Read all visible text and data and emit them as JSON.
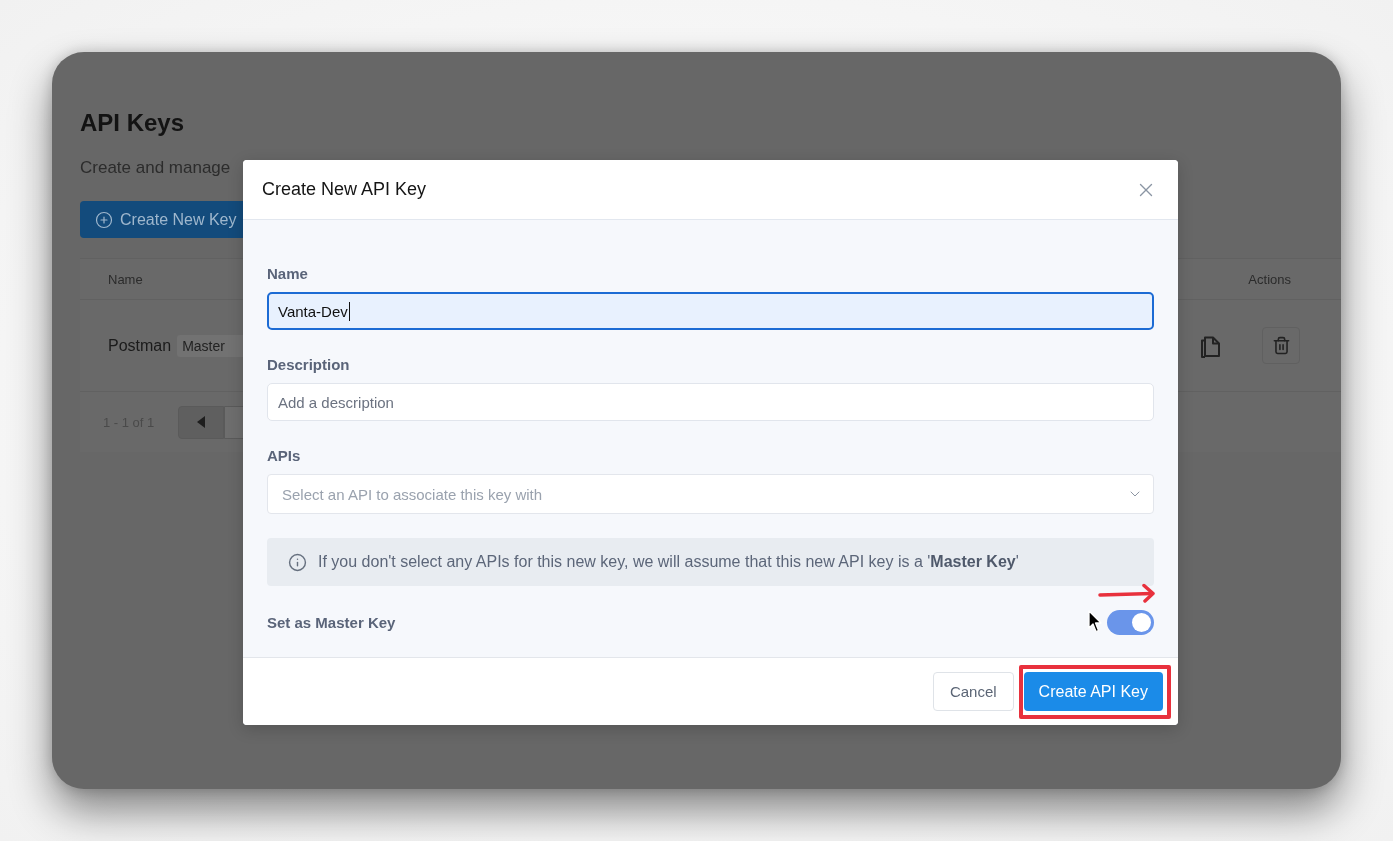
{
  "page": {
    "title": "API Keys",
    "subtitle": "Create and manage",
    "create_button": "Create New Key"
  },
  "table": {
    "columns": [
      "Name",
      "Actions"
    ],
    "rows": [
      {
        "name": "Postman",
        "badge": "Master"
      }
    ],
    "pagination": "1 - 1 of 1"
  },
  "dialog": {
    "title": "Create New API Key",
    "fields": [
      {
        "kind": "text",
        "label": "Name",
        "value": "Vanta-Dev",
        "focused": true
      },
      {
        "kind": "text",
        "label": "Description",
        "placeholder": "Add a description",
        "focused": false
      },
      {
        "kind": "select",
        "label": "APIs",
        "placeholder": "Select an API to associate this key with",
        "focused": false
      }
    ],
    "notice": "If you don't select any APIs for this new key, we will assume that this new API key is a '**Master Key**'",
    "master_key": {
      "label": "Set as Master Key",
      "on": true
    },
    "buttons": [
      {
        "label": "Cancel",
        "kind": "secondary"
      },
      {
        "label": "Create API Key",
        "kind": "primary"
      }
    ]
  }
}
